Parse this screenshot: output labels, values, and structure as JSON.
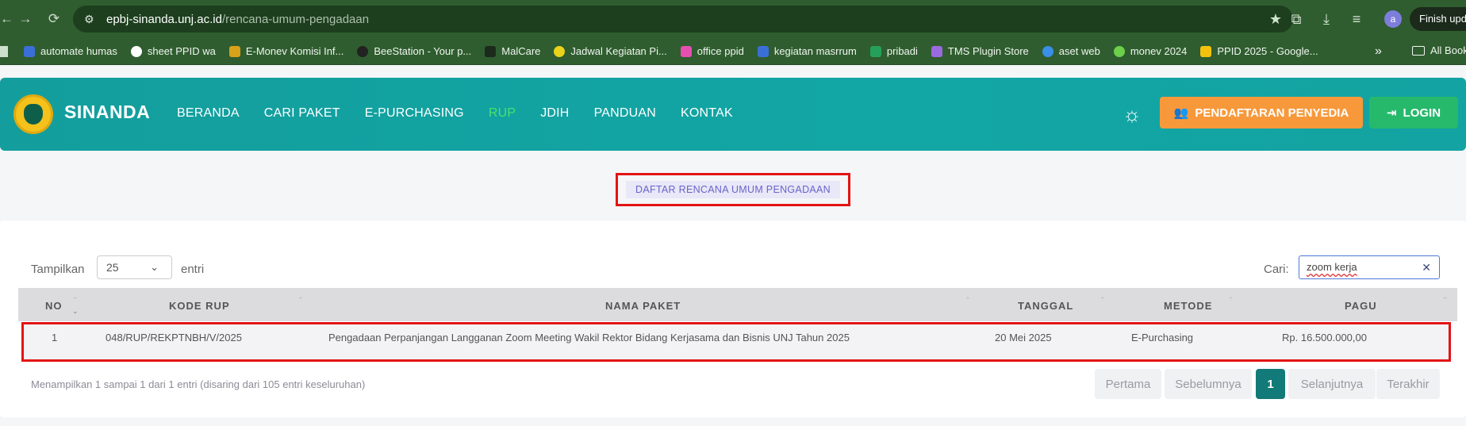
{
  "browser": {
    "url_host": "epbj-sinanda.unj.ac.id",
    "url_path": "/rencana-umum-pengadaan",
    "profile_initial": "a",
    "finish_update": "Finish upda",
    "bookmarks": [
      {
        "label": "automate humas",
        "color": "#3b6fd8"
      },
      {
        "label": "sheet PPID wa",
        "color": "#ffffff"
      },
      {
        "label": "E-Monev Komisi Inf...",
        "color": "#d9a21b"
      },
      {
        "label": "BeeStation - Your p...",
        "color": "#222222"
      },
      {
        "label": "MalCare",
        "color": "#1c2a1c"
      },
      {
        "label": "Jadwal Kegiatan Pi...",
        "color": "#e8d21a"
      },
      {
        "label": "office ppid",
        "color": "#e64fb0"
      },
      {
        "label": "kegiatan masrrum",
        "color": "#3b6fd8"
      },
      {
        "label": "pribadi",
        "color": "#25a05a"
      },
      {
        "label": "TMS Plugin Store",
        "color": "#9c6ae0"
      },
      {
        "label": "aset web",
        "color": "#3a8fe8"
      },
      {
        "label": "monev 2024",
        "color": "#6cd04a"
      },
      {
        "label": "PPID 2025 - Google...",
        "color": "#f4c20d"
      }
    ],
    "all_bookmarks": "All Book"
  },
  "header": {
    "brand": "SINANDA",
    "menu": [
      "BERANDA",
      "CARI PAKET",
      "E-PURCHASING",
      "RUP",
      "JDIH",
      "PANDUAN",
      "KONTAK"
    ],
    "active_menu": "RUP",
    "register_button": "PENDAFTARAN PENYEDIA",
    "login_button": "LOGIN"
  },
  "page_title": "DAFTAR RENCANA UMUM PENGADAAN",
  "controls": {
    "show_label": "Tampilkan",
    "show_value": "25",
    "entries_label": "entri",
    "search_label": "Cari:",
    "search_value": "zoom kerja"
  },
  "table": {
    "columns": [
      "NO",
      "KODE RUP",
      "NAMA PAKET",
      "TANGGAL",
      "METODE",
      "PAGU"
    ],
    "rows": [
      {
        "no": "1",
        "kode": "048/RUP/REKPTNBH/V/2025",
        "nama": "Pengadaan Perpanjangan Langganan Zoom Meeting Wakil Rektor Bidang Kerjasama dan Bisnis UNJ Tahun 2025",
        "tanggal": "20 Mei 2025",
        "metode": "E-Purchasing",
        "pagu": "Rp. 16.500.000,00"
      }
    ]
  },
  "footer": {
    "info": "Menampilkan 1 sampai 1 dari 1 entri (disaring dari 105 entri keseluruhan)",
    "pagination": {
      "first": "Pertama",
      "prev": "Sebelumnya",
      "current": "1",
      "next": "Selanjutnya",
      "last": "Terakhir"
    }
  }
}
